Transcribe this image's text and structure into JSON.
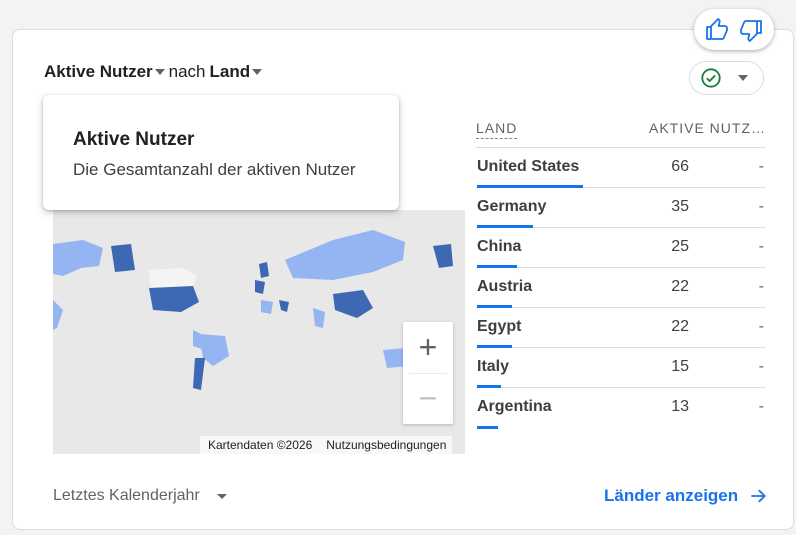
{
  "header": {
    "metric_label": "Aktive Nutzer",
    "by_label": "nach",
    "dimension_label": "Land"
  },
  "tooltip": {
    "title": "Aktive Nutzer",
    "description": "Die Gesamtanzahl der aktiven Nutzer"
  },
  "map": {
    "attribution": "Kartendaten ©2026",
    "terms": "Nutzungsbedingungen",
    "zoom_in": "+",
    "zoom_out": "−",
    "colors": {
      "high": "#3d68b3",
      "low": "#94b4f2",
      "none": "#e8e8e8"
    }
  },
  "table": {
    "col_country": "LAND",
    "col_value": "AKTIVE NUTZ…",
    "max_value": 66,
    "rows": [
      {
        "country": "United States",
        "value": "66",
        "extra": "-",
        "share": 1.0
      },
      {
        "country": "Germany",
        "value": "35",
        "extra": "-",
        "share": 0.53
      },
      {
        "country": "China",
        "value": "25",
        "extra": "-",
        "share": 0.38
      },
      {
        "country": "Austria",
        "value": "22",
        "extra": "-",
        "share": 0.33
      },
      {
        "country": "Egypt",
        "value": "22",
        "extra": "-",
        "share": 0.33
      },
      {
        "country": "Italy",
        "value": "15",
        "extra": "-",
        "share": 0.23
      },
      {
        "country": "Argentina",
        "value": "13",
        "extra": "-",
        "share": 0.2
      }
    ]
  },
  "footer": {
    "period": "Letztes Kalenderjahr",
    "view_link": "Länder anzeigen"
  },
  "icons": {
    "thumbs_up": "thumbs-up-icon",
    "thumbs_down": "thumbs-down-icon",
    "status": "check-circle-icon",
    "arrow": "arrow-right-icon"
  },
  "accent_color": "#1a73e8",
  "status_color": "#188038"
}
